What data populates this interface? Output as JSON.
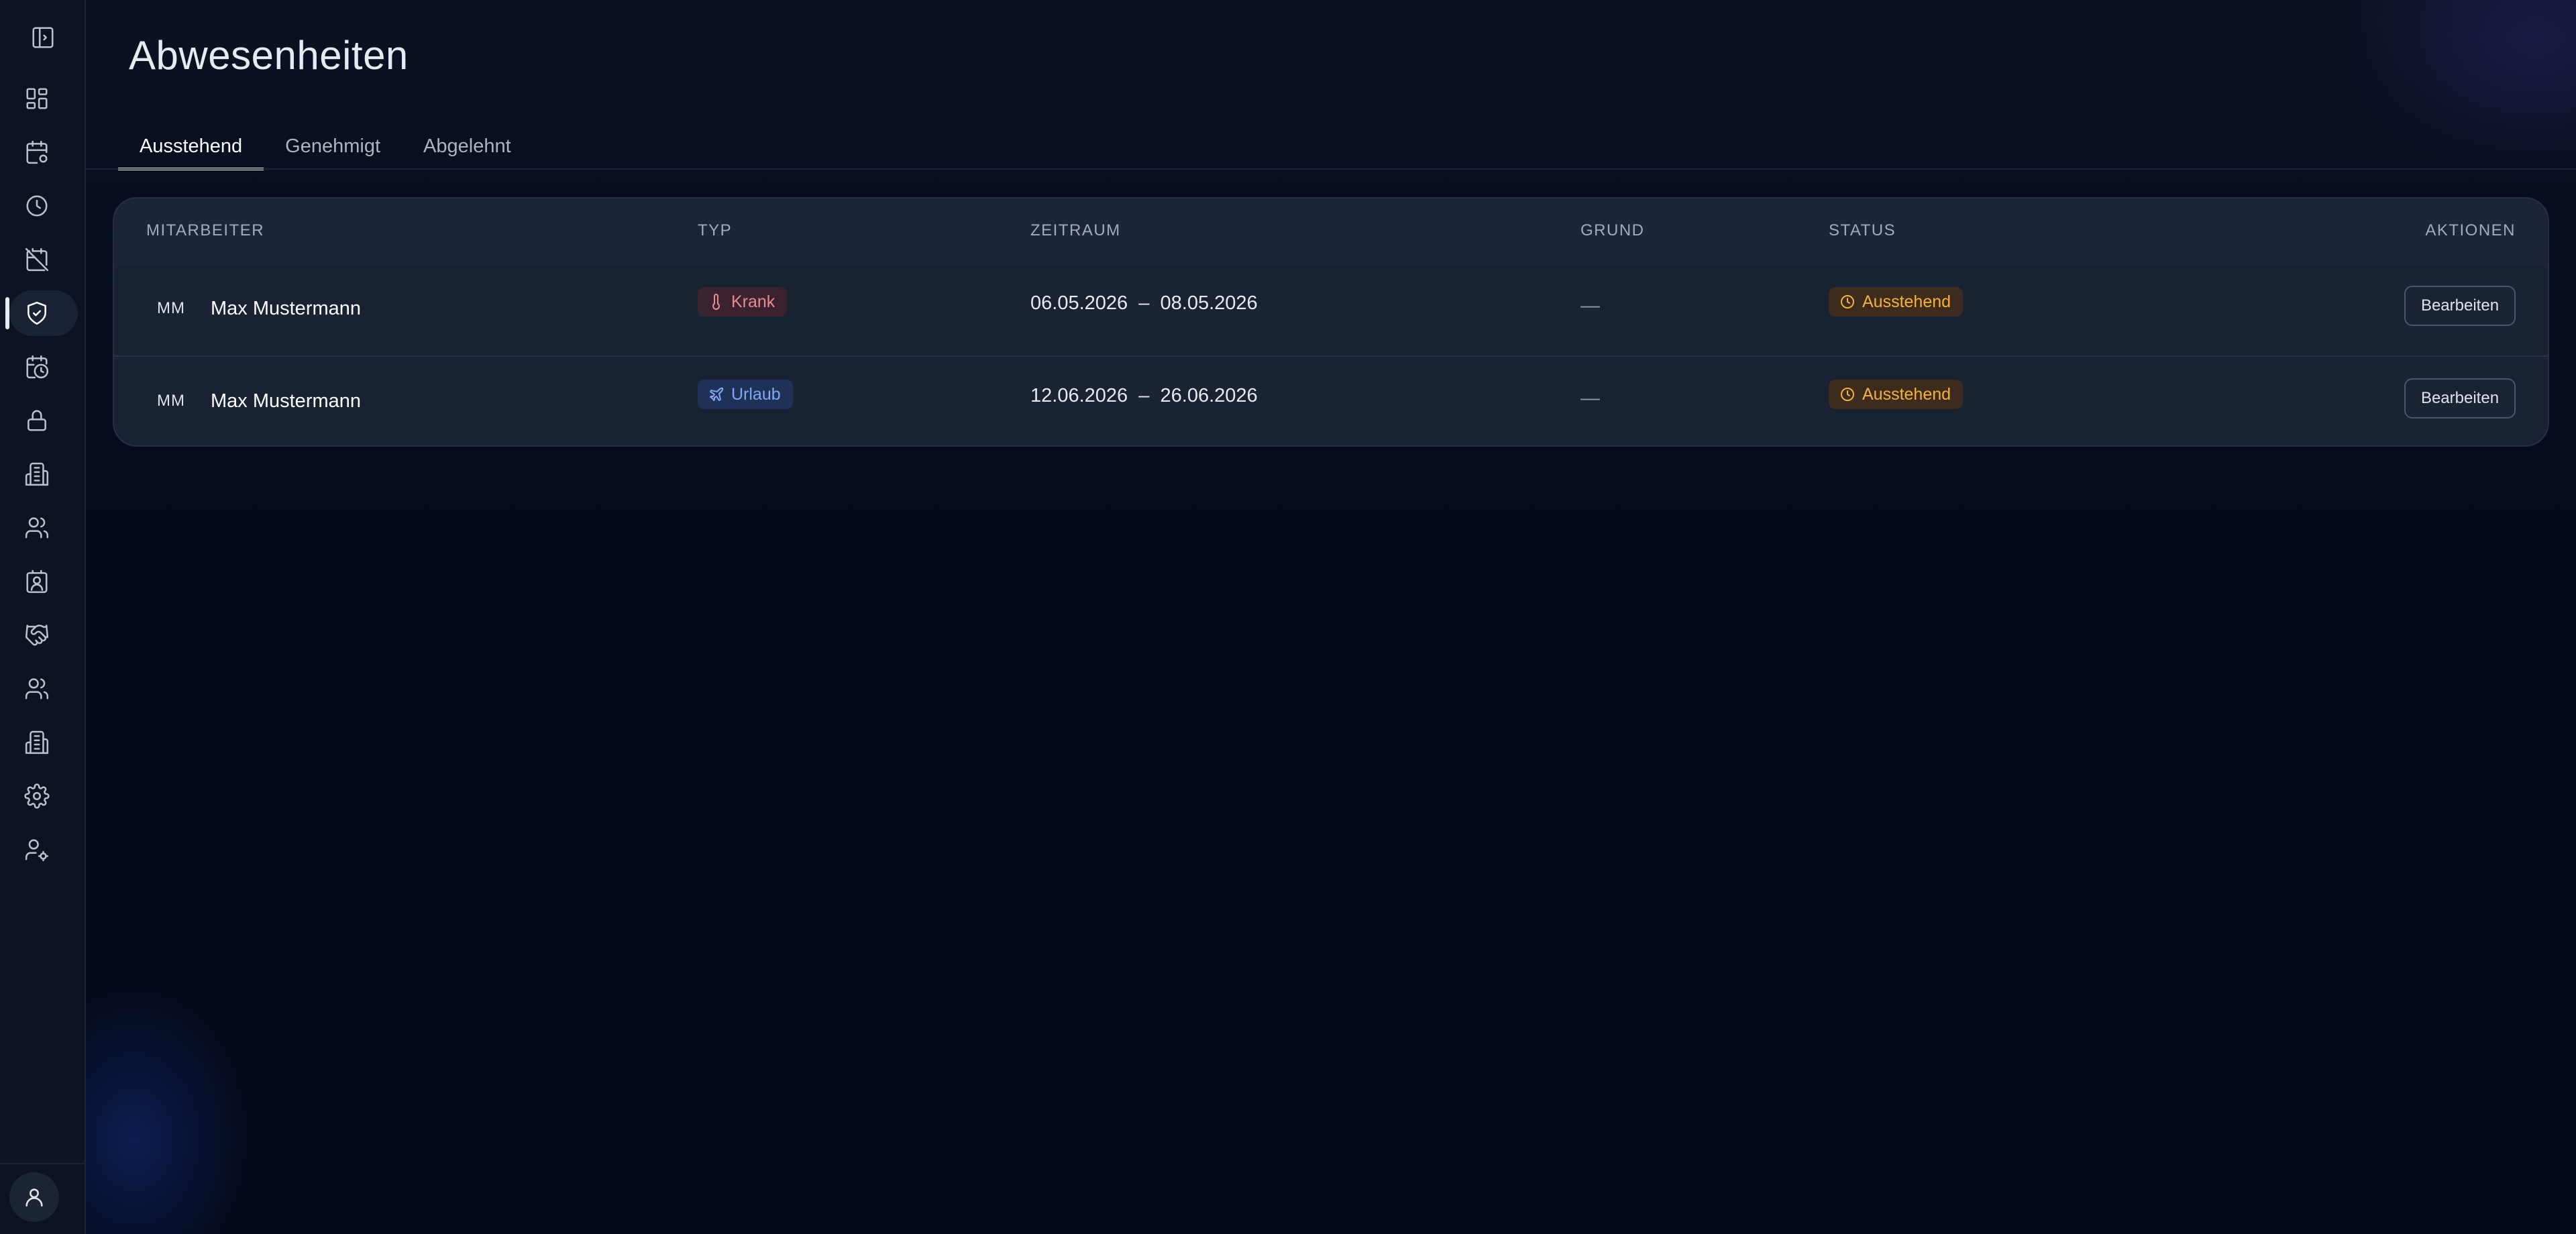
{
  "page": {
    "title": "Abwesenheiten"
  },
  "sidebar": {
    "toggle_icon": "sidebar-toggle-icon",
    "items": [
      {
        "icon": "dashboard-icon",
        "active": false
      },
      {
        "icon": "calendar-settings-icon",
        "active": false
      },
      {
        "icon": "clock-icon",
        "active": false
      },
      {
        "icon": "calendar-off-icon",
        "active": false
      },
      {
        "icon": "shield-check-icon",
        "active": true
      },
      {
        "icon": "calendar-clock-icon",
        "active": false
      },
      {
        "icon": "lock-icon",
        "active": false
      },
      {
        "icon": "building-icon",
        "active": false
      },
      {
        "icon": "users-icon",
        "active": false
      },
      {
        "icon": "contact-icon",
        "active": false
      },
      {
        "icon": "handshake-icon",
        "active": false
      },
      {
        "icon": "users-icon",
        "active": false
      },
      {
        "icon": "building-icon",
        "active": false
      },
      {
        "icon": "gear-icon",
        "active": false
      },
      {
        "icon": "user-settings-icon",
        "active": false
      }
    ],
    "profile_icon": "user-icon"
  },
  "tabs": [
    {
      "label": "Ausstehend",
      "active": true
    },
    {
      "label": "Genehmigt",
      "active": false
    },
    {
      "label": "Abgelehnt",
      "active": false
    }
  ],
  "table": {
    "headers": {
      "employee": "MITARBEITER",
      "type": "TYP",
      "period": "ZEITRAUM",
      "reason": "GRUND",
      "status": "STATUS",
      "actions": "AKTIONEN"
    },
    "rows": [
      {
        "initials": "MM",
        "name": "Max Mustermann",
        "type": "Krank",
        "type_icon": "thermometer-icon",
        "period": "06.05.2026  –  08.05.2026",
        "reason": "—",
        "status": "Ausstehend",
        "action": "Bearbeiten"
      },
      {
        "initials": "MM",
        "name": "Max Mustermann",
        "type": "Urlaub",
        "type_icon": "plane-icon",
        "period": "12.06.2026  –  26.06.2026",
        "reason": "—",
        "status": "Ausstehend",
        "action": "Bearbeiten"
      }
    ]
  },
  "colors": {
    "background": "#030817",
    "card": "#1a2333",
    "krank": "#e88c8f",
    "urlaub": "#7fa8f5",
    "pending": "#f4b13b"
  }
}
